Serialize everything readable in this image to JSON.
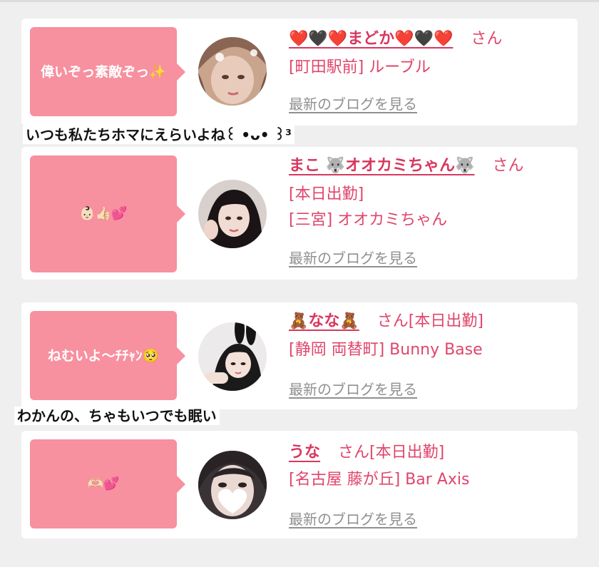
{
  "caption1": "いつも私たちホマにえらいよね꒰ •ᴗ• ꒱³",
  "caption2": "わかんの、ちゃもいつでも眠い",
  "cards": [
    {
      "bubble": "偉いぞっ素敵ぞっ✨",
      "name": "❤️🖤❤️まどか❤️🖤❤️",
      "san": "さん",
      "lines": [
        "[町田駅前] ルーブル"
      ],
      "blog": "最新のブログを見る"
    },
    {
      "bubble": "👶🏻👍🏻💕",
      "name": "まこ 🐺オオカミちゃん🐺",
      "san": "さん",
      "lines": [
        "[本日出勤]",
        "[三宮] オオカミちゃん"
      ],
      "blog": "最新のブログを見る"
    },
    {
      "bubble": "ねむいよ〜ﾁﾁｬﾝ🥺",
      "name": "🧸なな🧸",
      "san": "さん[本日出勤]",
      "lines": [
        "[静岡 両替町] Bunny Base"
      ],
      "blog": "最新のブログを見る"
    },
    {
      "bubble": "🫶🏻💕",
      "name": "うな",
      "san": "さん[本日出勤]",
      "lines": [
        "[名古屋 藤が丘] Bar Axis"
      ],
      "blog": "最新のブログを見る"
    }
  ],
  "colors": {
    "bubble": "#f7909f",
    "accent": "#e0456a",
    "background": "#efefef"
  }
}
